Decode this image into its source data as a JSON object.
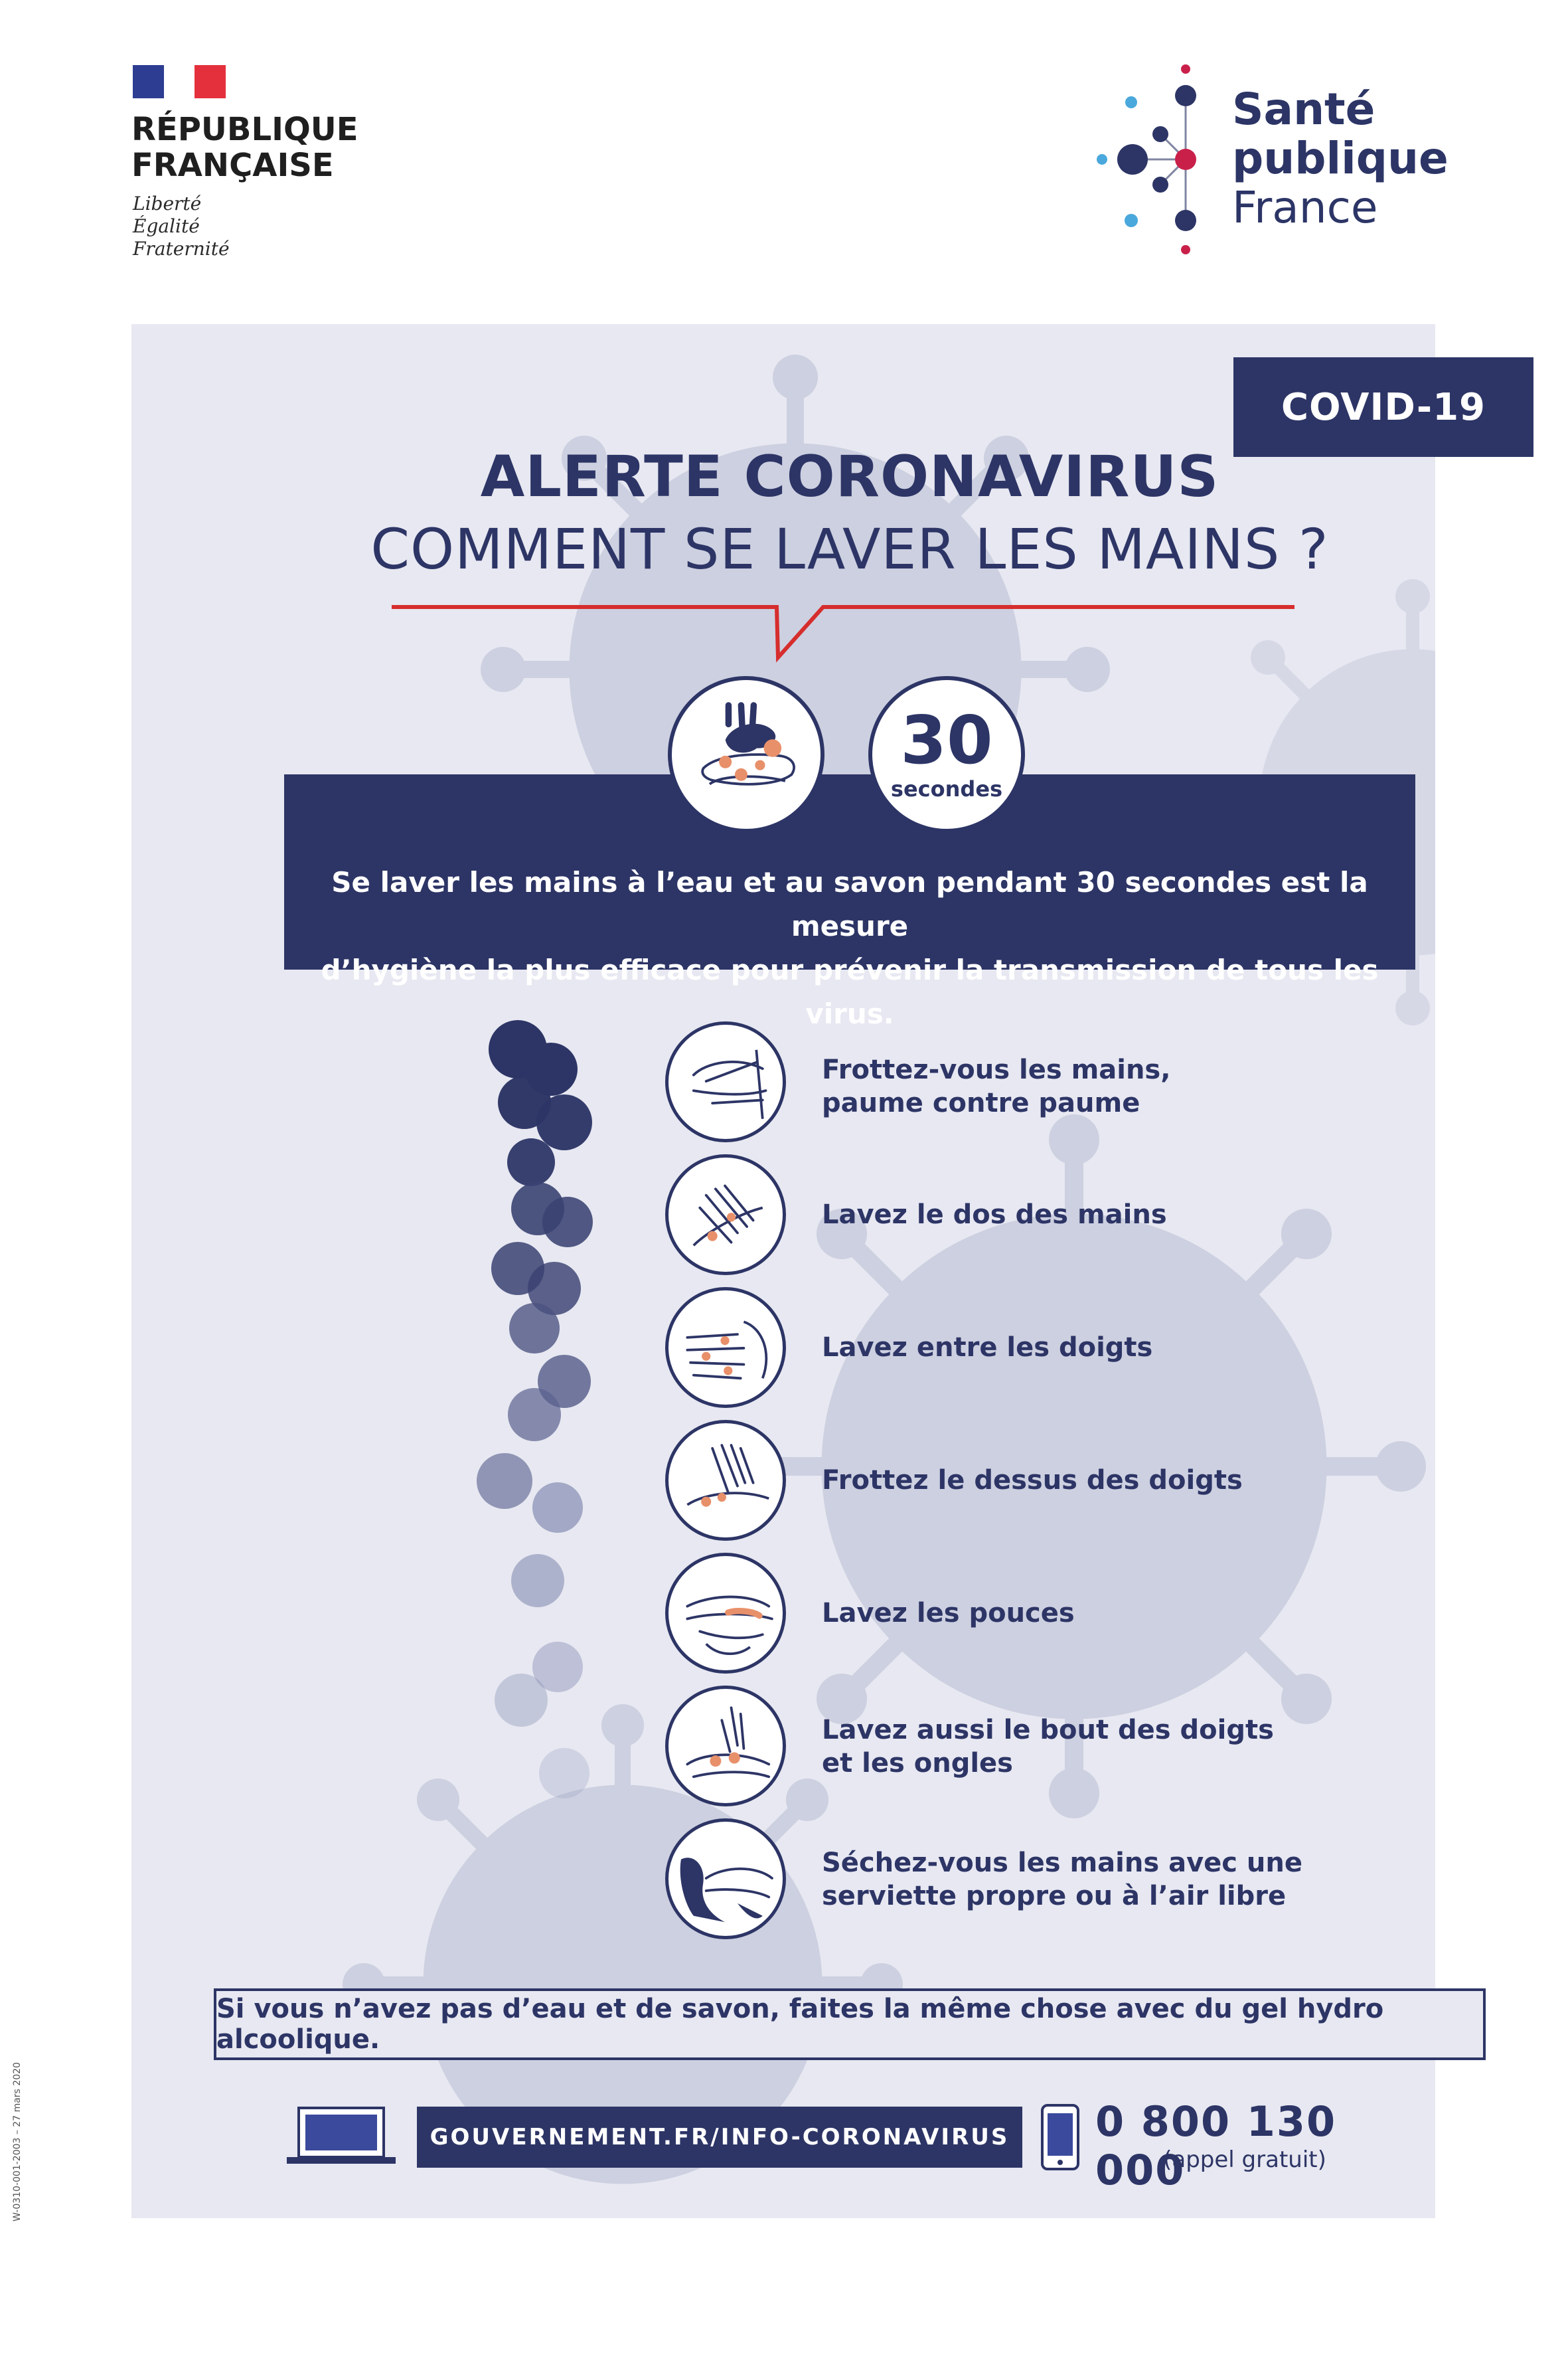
{
  "header": {
    "republic_line1": "RÉPUBLIQUE",
    "republic_line2": "FRANÇAISE",
    "motto": [
      "Liberté",
      "Égalité",
      "Fraternité"
    ],
    "spf_line1": "Santé",
    "spf_line2": "publique",
    "spf_line3": "France"
  },
  "poster": {
    "badge": "COVID-19",
    "title": "ALERTE CORONAVIRUS",
    "subtitle": "COMMENT SE LAVER LES MAINS ?",
    "duration_number": "30",
    "duration_unit": "secondes",
    "intro_line1": "Se laver les mains à l’eau et au savon pendant 30 secondes est la mesure",
    "intro_line2": "d’hygiène la plus efficace pour prévenir la transmission de tous les virus.",
    "steps": [
      {
        "line1": "Frottez-vous les mains,",
        "line2": "paume contre paume",
        "icon": "palm-to-palm-icon"
      },
      {
        "line1": "Lavez le dos des mains",
        "line2": "",
        "icon": "back-of-hands-icon"
      },
      {
        "line1": "Lavez entre les doigts",
        "line2": "",
        "icon": "between-fingers-icon"
      },
      {
        "line1": "Frottez le dessus des doigts",
        "line2": "",
        "icon": "top-of-fingers-icon"
      },
      {
        "line1": "Lavez les pouces",
        "line2": "",
        "icon": "thumbs-icon"
      },
      {
        "line1": "Lavez aussi le bout des doigts",
        "line2": "et les ongles",
        "icon": "fingertips-nails-icon"
      },
      {
        "line1": "Séchez-vous les mains avec une",
        "line2": "serviette propre ou à l’air libre",
        "icon": "dry-hands-towel-icon"
      }
    ],
    "gel_note": "Si vous n’avez pas d’eau et de savon, faites la même chose avec du gel hydro alcoolique.",
    "website": "GOUVERNEMENT.FR/INFO-CORONAVIRUS",
    "phone_number": "0 800 130 000",
    "phone_note": "(appel gratuit)",
    "reference": "W-0310-001-2003 – 27 mars 2020"
  },
  "colors": {
    "navy": "#2d3566",
    "panel_bg": "#e7e8f1",
    "red_accent": "#d62d2d",
    "soap_orange": "#e8906a"
  }
}
